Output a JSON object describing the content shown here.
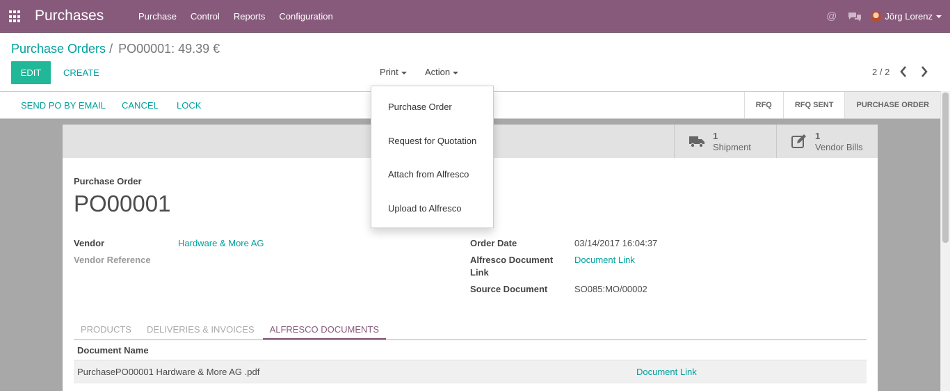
{
  "navbar": {
    "brand": "Purchases",
    "menu": [
      "Purchase",
      "Control",
      "Reports",
      "Configuration"
    ],
    "at_symbol": "@",
    "user": "Jörg Lorenz",
    "color": "#875a7b"
  },
  "breadcrumb": {
    "parent": "Purchase Orders",
    "separator": "/",
    "current": "PO00001: 49.39 €"
  },
  "buttons": {
    "edit": "Edit",
    "create": "Create"
  },
  "sidebar": {
    "print": "Print",
    "action": "Action"
  },
  "print_menu": [
    "Purchase Order",
    "Request for Quotation",
    "Attach from Alfresco",
    "Upload to Alfresco"
  ],
  "pager": {
    "value": "2 / 2"
  },
  "header_buttons": [
    "Send PO by Email",
    "Cancel",
    "Lock"
  ],
  "stages": [
    {
      "label": "RFQ",
      "active": false
    },
    {
      "label": "RFQ Sent",
      "active": false
    },
    {
      "label": "Purchase Order",
      "active": true
    }
  ],
  "smart_buttons": [
    {
      "value": "1",
      "label": "Shipment",
      "icon": "truck-icon"
    },
    {
      "value": "1",
      "label": "Vendor Bills",
      "icon": "pencil-square-icon"
    }
  ],
  "form": {
    "title_label": "Purchase Order",
    "title": "PO00001",
    "vendor_label": "Vendor",
    "vendor": "Hardware & More AG",
    "vendor_ref_label": "Vendor Reference",
    "order_date_label": "Order Date",
    "order_date": "03/14/2017 16:04:37",
    "alfresco_link_label_line1": "Alfresco Document",
    "alfresco_link_label_line2": "Link",
    "alfresco_link": "Document Link",
    "source_doc_label": "Source Document",
    "source_doc": "SO085:MO/00002"
  },
  "tabs": [
    {
      "label": "Products",
      "active": false
    },
    {
      "label": "Deliveries & Invoices",
      "active": false
    },
    {
      "label": "Alfresco Documents",
      "active": true
    }
  ],
  "table": {
    "header": "Document Name",
    "rows": [
      {
        "name": "PurchasePO00001 Hardware & More AG .pdf",
        "link": "Document Link"
      }
    ]
  },
  "colors": {
    "primary": "#21b799",
    "link": "#00a09d",
    "accent": "#875a7b"
  }
}
